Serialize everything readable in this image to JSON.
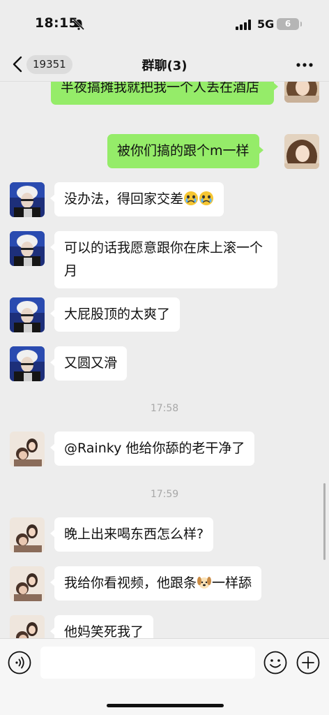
{
  "status": {
    "time": "18:15",
    "network": "5G",
    "battery": "6"
  },
  "nav": {
    "back_count": "19351",
    "title": "群聊(3)"
  },
  "messages": [
    {
      "side": "out",
      "sender": "me",
      "text": "半夜搞摊我就把我一个人丢在酒店"
    },
    {
      "side": "out",
      "sender": "me",
      "text": "被你们搞的跟个m一样"
    },
    {
      "side": "in",
      "sender": "art-avatar",
      "text": "没办法，得回家交差",
      "emoji": [
        "crying-face",
        "crying-face"
      ]
    },
    {
      "side": "in",
      "sender": "art-avatar",
      "text": "可以的话我愿意跟你在床上滚一个月"
    },
    {
      "side": "in",
      "sender": "art-avatar",
      "text": "大屁股顶的太爽了"
    },
    {
      "side": "in",
      "sender": "art-avatar",
      "text": "又圆又滑"
    },
    {
      "side": "time",
      "text": "17:58"
    },
    {
      "side": "in",
      "sender": "photo-avatar",
      "text": "@Rainky 他给你舔的老干净了"
    },
    {
      "side": "time",
      "text": "17:59"
    },
    {
      "side": "in",
      "sender": "photo-avatar",
      "text": "晚上出来喝东西怎么样?"
    },
    {
      "side": "in",
      "sender": "photo-avatar",
      "text_before": "我给你看视频，他跟条",
      "emoji": [
        "dog-face"
      ],
      "text_after": "一样舔"
    },
    {
      "side": "in",
      "sender": "photo-avatar",
      "text": "他妈笑死我了"
    }
  ],
  "input": {
    "placeholder": ""
  },
  "icons": {
    "back": "chevron-left-icon",
    "more": "more-dots-icon",
    "voice": "voice-icon",
    "emoji": "smiley-icon",
    "plus": "plus-icon",
    "silent": "bell-slash-icon"
  },
  "colors": {
    "out_bubble": "#95ec69",
    "in_bubble": "#ffffff",
    "background": "#ededed"
  }
}
